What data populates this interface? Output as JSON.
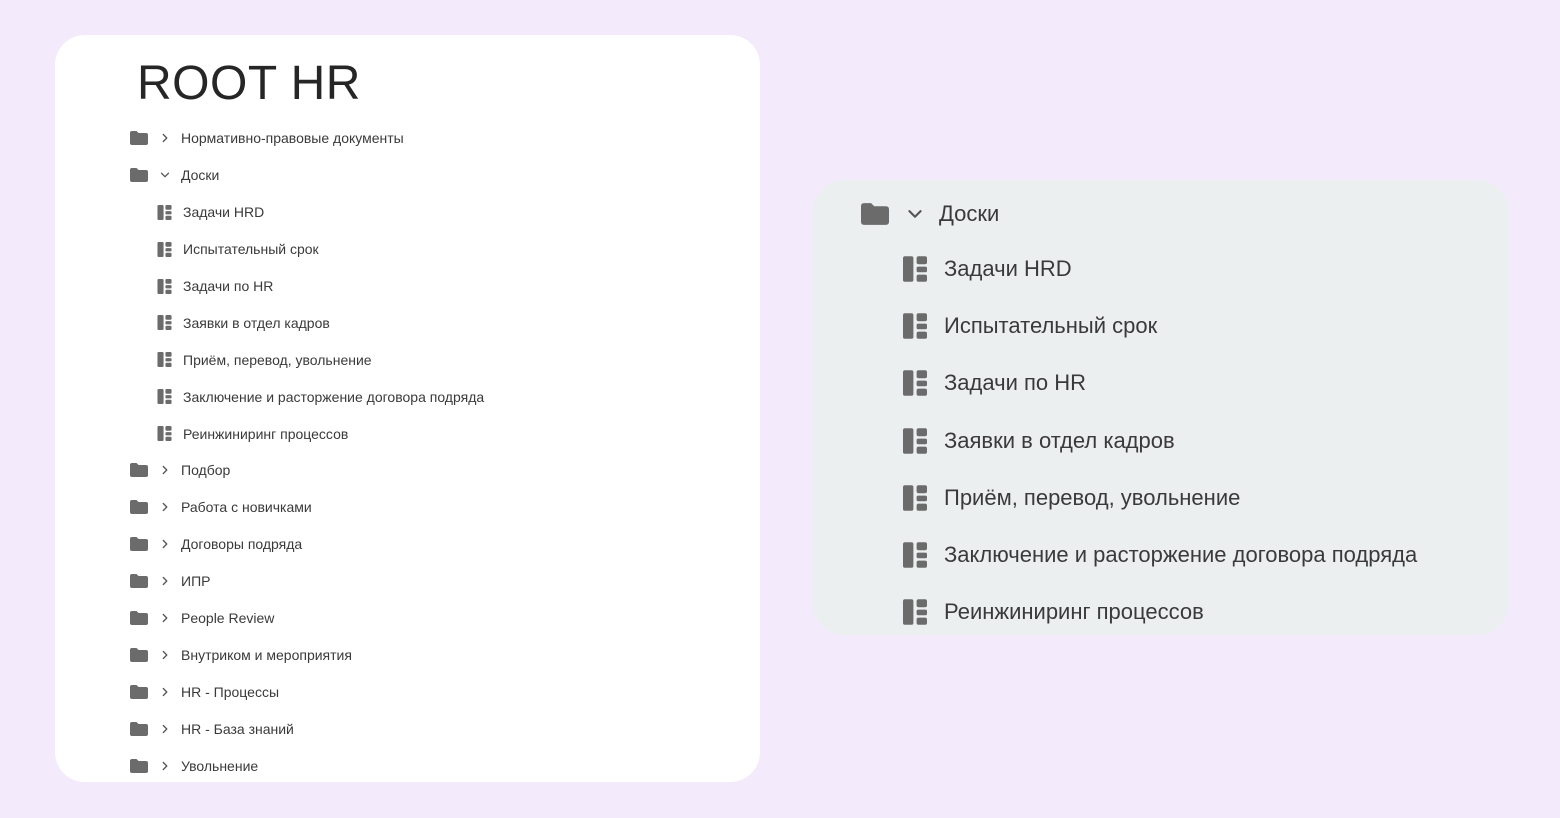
{
  "left_panel": {
    "title": "ROOT HR",
    "items": [
      {
        "type": "folder",
        "label": "Нормативно-правовые документы",
        "expanded": false,
        "icon": "folder-icon"
      },
      {
        "type": "folder",
        "label": "Доски",
        "expanded": true,
        "icon": "folder-icon",
        "children": [
          {
            "type": "board",
            "label": "Задачи HRD",
            "icon": "board-icon"
          },
          {
            "type": "board",
            "label": "Испытательный срок",
            "icon": "board-icon"
          },
          {
            "type": "board",
            "label": "Задачи по HR",
            "icon": "board-icon"
          },
          {
            "type": "board",
            "label": "Заявки в отдел кадров",
            "icon": "board-icon"
          },
          {
            "type": "board",
            "label": "Приём, перевод, увольнение",
            "icon": "board-icon"
          },
          {
            "type": "board",
            "label": "Заключение и расторжение договора подряда",
            "icon": "board-icon"
          },
          {
            "type": "board",
            "label": "Реинжиниринг процессов",
            "icon": "board-icon"
          }
        ]
      },
      {
        "type": "folder",
        "label": "Подбор",
        "expanded": false,
        "icon": "folder-icon"
      },
      {
        "type": "folder",
        "label": "Работа с новичками",
        "expanded": false,
        "icon": "folder-icon"
      },
      {
        "type": "folder",
        "label": "Договоры подряда",
        "expanded": false,
        "icon": "folder-icon"
      },
      {
        "type": "folder",
        "label": "ИПР",
        "expanded": false,
        "icon": "folder-icon"
      },
      {
        "type": "folder",
        "label": "People Review",
        "expanded": false,
        "icon": "folder-icon"
      },
      {
        "type": "folder",
        "label": "Внутриком и мероприятия",
        "expanded": false,
        "icon": "folder-icon"
      },
      {
        "type": "folder",
        "label": "HR - Процессы",
        "expanded": false,
        "icon": "folder-icon"
      },
      {
        "type": "folder",
        "label": "HR - База знаний",
        "expanded": false,
        "icon": "folder-icon"
      },
      {
        "type": "folder",
        "label": "Увольнение",
        "expanded": false,
        "icon": "folder-icon"
      }
    ]
  },
  "right_panel": {
    "folder": {
      "label": "Доски",
      "expanded": true,
      "icon": "folder-icon"
    },
    "children": [
      {
        "label": "Задачи HRD",
        "icon": "board-icon"
      },
      {
        "label": "Испытательный срок",
        "icon": "board-icon"
      },
      {
        "label": "Задачи по HR",
        "icon": "board-icon"
      },
      {
        "label": "Заявки в отдел кадров",
        "icon": "board-icon"
      },
      {
        "label": "Приём, перевод, увольнение",
        "icon": "board-icon"
      },
      {
        "label": "Заключение и расторжение договора подряда",
        "icon": "board-icon"
      },
      {
        "label": "Реинжиниринг процессов",
        "icon": "board-icon"
      }
    ]
  },
  "colors": {
    "background": "#f3ebfb",
    "left_card": "#ffffff",
    "right_card": "#eceff0",
    "icon": "#6b6b6b",
    "text": "#3a3a3a"
  }
}
